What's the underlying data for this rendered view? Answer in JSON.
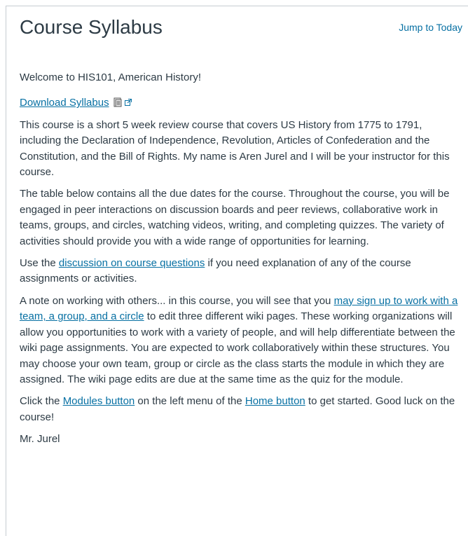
{
  "header": {
    "title": "Course Syllabus",
    "jump_link": "Jump to Today"
  },
  "body": {
    "welcome": "Welcome to HIS101, American History!",
    "download_link": "Download Syllabus",
    "para1": "This course is a short 5 week review course that covers US History from 1775 to 1791, including the Declaration of Independence, Revolution, Articles of Confederation and the Constitution, and the Bill of Rights. My name is Aren Jurel and I will be your instructor for this course.",
    "para2": "The table below contains all the due dates for the course. Throughout the course, you will be engaged in peer interactions on discussion boards and peer reviews, collaborative work in teams, groups, and circles, watching videos, writing, and completing quizzes. The variety of activities should provide you with a wide range of opportunities for learning.",
    "para3": {
      "before": "Use the ",
      "link": "discussion on course questions",
      "after": " if you need explanation of any of the course assignments or activities."
    },
    "para4": {
      "before": "A note on working with others... in this course, you will see that you ",
      "link": "may sign up to work with a team, a group, and a circle",
      "after": " to edit three different wiki pages. These working organizations will allow you opportunities to work with a variety of people, and will help differentiate between the wiki page assignments. You are expected to work collaboratively within these structures. You may choose your own team, group or circle as the class starts the module in which they are assigned. The wiki page edits are due at the same time as the quiz for the module."
    },
    "para5": {
      "before": "Click the ",
      "link1": "Modules button",
      "middle": " on the left menu of the ",
      "link2": "Home button",
      "after": " to get started. Good luck on the course!"
    },
    "signoff": "Mr. Jurel"
  },
  "colors": {
    "text": "#2d3b45",
    "link": "#0770a3",
    "border": "#c7cdd1"
  },
  "icons": [
    "document-preview-icon",
    "external-link-icon"
  ]
}
